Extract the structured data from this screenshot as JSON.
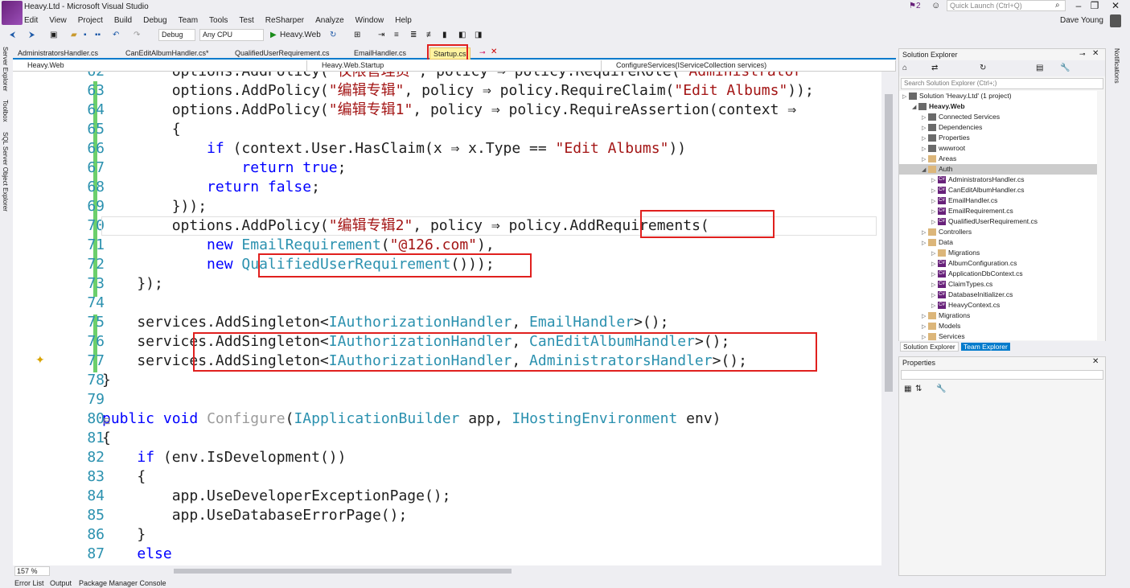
{
  "window": {
    "title": "Heavy.Ltd - Microsoft Visual Studio",
    "notification_count": "2",
    "quick_launch_placeholder": "Quick Launch (Ctrl+Q)",
    "user": "Dave Young"
  },
  "menu": [
    "Edit",
    "View",
    "Project",
    "Build",
    "Debug",
    "Team",
    "Tools",
    "Test",
    "ReSharper",
    "Analyze",
    "Window",
    "Help"
  ],
  "toolbar": {
    "config": "Debug",
    "platform": "Any CPU",
    "start_label": "Heavy.Web"
  },
  "left_strip": [
    "Server Explorer",
    "Toolbox",
    "SQL Server Object Explorer"
  ],
  "tabs": [
    {
      "label": "AdministratorsHandler.cs"
    },
    {
      "label": "CanEditAlbumHandler.cs*"
    },
    {
      "label": "QualifiedUserRequirement.cs"
    },
    {
      "label": "EmailHandler.cs"
    },
    {
      "label": "Startup.cs"
    }
  ],
  "navbar": {
    "project": "Heavy.Web",
    "class": "Heavy.Web.Startup",
    "member": "ConfigureServices(IServiceCollection services)"
  },
  "editor": {
    "zoom": "157 %",
    "lines": [
      {
        "n": "62",
        "t": "        options.AddPolicy(\"仅限管理员\", policy ⇒ policy.RequireRole(\"Administrator"
      },
      {
        "n": "63",
        "t": "        options.AddPolicy(\"编辑专辑\", policy ⇒ policy.RequireClaim(\"Edit Albums\"));"
      },
      {
        "n": "64",
        "t": "        options.AddPolicy(\"编辑专辑1\", policy ⇒ policy.RequireAssertion(context ⇒"
      },
      {
        "n": "65",
        "t": "        {"
      },
      {
        "n": "66",
        "t": "            if (context.User.HasClaim(x ⇒ x.Type == \"Edit Albums\"))"
      },
      {
        "n": "67",
        "t": "                return true;"
      },
      {
        "n": "68",
        "t": "            return false;"
      },
      {
        "n": "69",
        "t": "        }));"
      },
      {
        "n": "70",
        "t": "        options.AddPolicy(\"编辑专辑2\", policy ⇒ policy.AddRequirements("
      },
      {
        "n": "71",
        "t": "            new EmailRequirement(\"@126.com\"),"
      },
      {
        "n": "72",
        "t": "            new QualifiedUserRequirement()));"
      },
      {
        "n": "73",
        "t": "    });"
      },
      {
        "n": "74",
        "t": ""
      },
      {
        "n": "75",
        "t": "    services.AddSingleton<IAuthorizationHandler, EmailHandler>();"
      },
      {
        "n": "76",
        "t": "    services.AddSingleton<IAuthorizationHandler, CanEditAlbumHandler>();"
      },
      {
        "n": "77",
        "t": "    services.AddSingleton<IAuthorizationHandler, AdministratorsHandler>();"
      },
      {
        "n": "78",
        "t": "}"
      },
      {
        "n": "79",
        "t": ""
      },
      {
        "n": "80",
        "t": "public void Configure(IApplicationBuilder app, IHostingEnvironment env)"
      },
      {
        "n": "81",
        "t": "{"
      },
      {
        "n": "82",
        "t": "    if (env.IsDevelopment())"
      },
      {
        "n": "83",
        "t": "    {"
      },
      {
        "n": "84",
        "t": "        app.UseDeveloperExceptionPage();"
      },
      {
        "n": "85",
        "t": "        app.UseDatabaseErrorPage();"
      },
      {
        "n": "86",
        "t": "    }"
      },
      {
        "n": "87",
        "t": "    else"
      }
    ]
  },
  "solution_explorer": {
    "title": "Solution Explorer",
    "search_placeholder": "Search Solution Explorer (Ctrl+;)",
    "items": [
      {
        "label": "Solution 'Heavy.Ltd' (1 project)",
        "depth": 0,
        "kind": "solution"
      },
      {
        "label": "Heavy.Web",
        "depth": 1,
        "kind": "project"
      },
      {
        "label": "Connected Services",
        "depth": 2,
        "kind": "node"
      },
      {
        "label": "Dependencies",
        "depth": 2,
        "kind": "node"
      },
      {
        "label": "Properties",
        "depth": 2,
        "kind": "node"
      },
      {
        "label": "wwwroot",
        "depth": 2,
        "kind": "node"
      },
      {
        "label": "Areas",
        "depth": 2,
        "kind": "folder"
      },
      {
        "label": "Auth",
        "depth": 2,
        "kind": "folder",
        "selected": true
      },
      {
        "label": "AdministratorsHandler.cs",
        "depth": 3,
        "kind": "cs"
      },
      {
        "label": "CanEditAlbumHandler.cs",
        "depth": 3,
        "kind": "cs"
      },
      {
        "label": "EmailHandler.cs",
        "depth": 3,
        "kind": "cs"
      },
      {
        "label": "EmailRequirement.cs",
        "depth": 3,
        "kind": "cs"
      },
      {
        "label": "QualifiedUserRequirement.cs",
        "depth": 3,
        "kind": "cs"
      },
      {
        "label": "Controllers",
        "depth": 2,
        "kind": "folder"
      },
      {
        "label": "Data",
        "depth": 2,
        "kind": "folder"
      },
      {
        "label": "Migrations",
        "depth": 3,
        "kind": "folder"
      },
      {
        "label": "AlbumConfiguration.cs",
        "depth": 3,
        "kind": "cs"
      },
      {
        "label": "ApplicationDbContext.cs",
        "depth": 3,
        "kind": "cs"
      },
      {
        "label": "ClaimTypes.cs",
        "depth": 3,
        "kind": "cs"
      },
      {
        "label": "DatabaseInitializer.cs",
        "depth": 3,
        "kind": "cs"
      },
      {
        "label": "HeavyContext.cs",
        "depth": 3,
        "kind": "cs"
      },
      {
        "label": "Migrations",
        "depth": 2,
        "kind": "folder"
      },
      {
        "label": "Models",
        "depth": 2,
        "kind": "folder"
      },
      {
        "label": "Services",
        "depth": 2,
        "kind": "folder"
      }
    ],
    "tabs": [
      "Solution Explorer",
      "Team Explorer"
    ]
  },
  "properties": {
    "title": "Properties"
  },
  "right_strip": [
    "Notifications"
  ],
  "bottom_tabs": [
    "Error List",
    "Output",
    "Package Manager Console"
  ],
  "colors": {
    "accent": "#007acc",
    "highlight_box": "#e0201e",
    "active_tab": "#fff3a0"
  }
}
